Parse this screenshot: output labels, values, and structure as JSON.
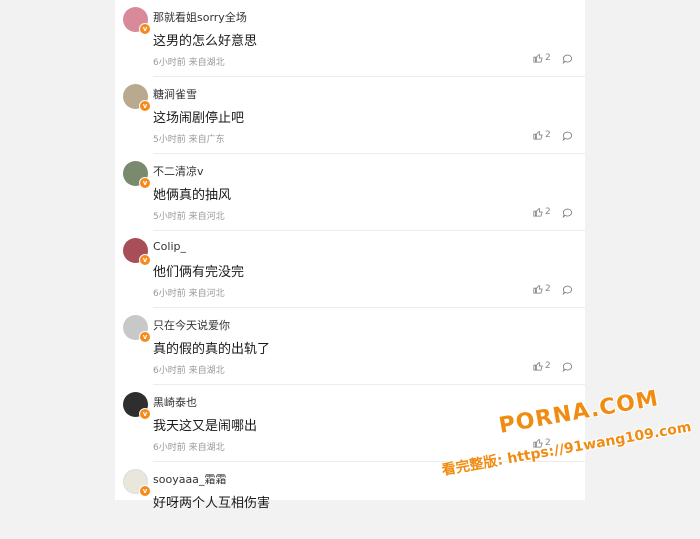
{
  "colors": {
    "accent": "#f78a1c",
    "text": "#1a1a1a",
    "meta": "#999999",
    "background": "#f2f2f2"
  },
  "comments": [
    {
      "username": "那就看姐sorry全场",
      "content": "这男的怎么好意思",
      "meta": "6小时前 来自湖北",
      "likes": "2",
      "avatar_color": "#d98a9a"
    },
    {
      "username": "糖涧雀雪",
      "content": "这场闹剧停止吧",
      "meta": "5小时前 来自广东",
      "likes": "2",
      "avatar_color": "#b9a98e"
    },
    {
      "username": "不二清凉v",
      "content": "她俩真的抽风",
      "meta": "5小时前 来自河北",
      "likes": "2",
      "avatar_color": "#7a8a6e"
    },
    {
      "username": "Colip_",
      "content": "他们俩有完没完",
      "meta": "6小时前 来自河北",
      "likes": "2",
      "avatar_color": "#a84e58"
    },
    {
      "username": "只在今天说爱你",
      "content": "真的假的真的出轨了",
      "meta": "6小时前 来自湖北",
      "likes": "2",
      "avatar_color": "#c8c8c8"
    },
    {
      "username": "黑崎泰也",
      "content": "我天这又是闹哪出",
      "meta": "6小时前 来自湖北",
      "likes": "2",
      "avatar_color": "#2e2e2e"
    },
    {
      "username": "sooyaaa_霜霜",
      "content": "好呀两个人互相伤害",
      "meta": "",
      "likes": "",
      "avatar_color": "#e9e6dc"
    }
  ],
  "watermark": {
    "line1": "PORNA.COM",
    "line2": "看完整版: https://91wang109.com"
  }
}
